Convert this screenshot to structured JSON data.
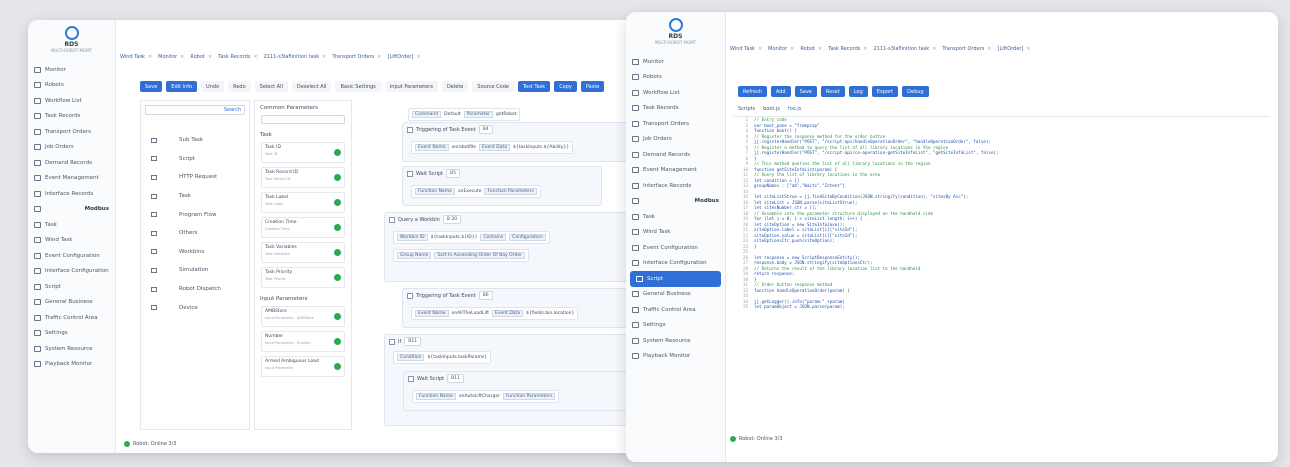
{
  "app": {
    "logo_name": "RDS",
    "logo_sub": "MULTI-ROBOT MGMT"
  },
  "colors": {
    "accent": "#2f6fd6",
    "online": "#2fa84f",
    "comment": "#2f8f46"
  },
  "left": {
    "sidebar": [
      {
        "label": "Monitor",
        "icon": "monitor-icon"
      },
      {
        "label": "Robots",
        "icon": "robot-icon"
      },
      {
        "label": "Workflow List",
        "icon": "list-icon"
      },
      {
        "label": "Task Records",
        "icon": "record-icon"
      },
      {
        "label": "Transport Orders",
        "icon": "transport-icon"
      },
      {
        "label": "Job Orders",
        "icon": "job-icon"
      },
      {
        "label": "Demand Records",
        "icon": "demand-icon"
      },
      {
        "label": "Event Management",
        "icon": "event-icon"
      },
      {
        "label": "Interface Records",
        "icon": "interface-icon"
      },
      {
        "label": "Modbus",
        "icon": "modbus-icon",
        "group": true
      },
      {
        "label": "Task",
        "icon": "task-icon"
      },
      {
        "label": "Wind Task",
        "icon": "wind-icon"
      },
      {
        "label": "Event Configuration",
        "icon": "event-config-icon"
      },
      {
        "label": "Interface Configuration",
        "icon": "interface-config-icon"
      },
      {
        "label": "Script",
        "icon": "script-icon"
      },
      {
        "label": "General Business",
        "icon": "business-icon"
      },
      {
        "label": "Traffic Control Area",
        "icon": "traffic-icon"
      },
      {
        "label": "Settings",
        "icon": "settings-icon"
      },
      {
        "label": "System Resource",
        "icon": "resource-icon"
      },
      {
        "label": "Playback Monitor",
        "icon": "playback-icon"
      }
    ],
    "tabs": [
      "Wind Task",
      "Monitor",
      "Robot",
      "Task Records",
      "2111-s3Iaflinition task",
      "Transport Orders",
      "[LiftOrder]"
    ],
    "toolbar": [
      "Save",
      "Edit Info",
      "Undo",
      "Redo",
      "Select All",
      "Deselect All",
      "Basic Settings",
      "Input Parameters",
      "Delete",
      "Source Code",
      "Test Task",
      "Copy",
      "Paste"
    ],
    "toolbar_primary": [
      0,
      1,
      10,
      11,
      12
    ],
    "search_label": "Search",
    "components": [
      "Sub Task",
      "Script",
      "HTTP Request",
      "Task",
      "Program Flow",
      "Others",
      "Workbins",
      "Simulation",
      "Robot Dispatch",
      "Device"
    ],
    "params_title": "Common Parameters",
    "task_title": "Task",
    "task_cards": [
      {
        "name": "Task ID",
        "desc": "Task ID"
      },
      {
        "name": "Task Record ID",
        "desc": "Task Record ID"
      },
      {
        "name": "Task Label",
        "desc": "Task Label"
      },
      {
        "name": "Creation Time",
        "desc": "Creation Time"
      },
      {
        "name": "Task Variables",
        "desc": "Task Variables"
      },
      {
        "name": "Task Priority",
        "desc": "Task Priority"
      }
    ],
    "input_title": "Input Parameters",
    "input_cards": [
      {
        "name": "AMBStore",
        "desc": "Input Parameter - AMBStore"
      },
      {
        "name": "Number",
        "desc": "Input Parameter - Number"
      },
      {
        "name": "Armed Ambiguous Load",
        "desc": "Input Parameter"
      }
    ],
    "flow": {
      "f1_cmd": "Command",
      "f1_val": "Default",
      "f1_param": "Parameter",
      "f1_pval": "getRobot",
      "f2_title": "Triggering of Task Event",
      "f2_badge": "B4",
      "f2_chip1": "Event Name",
      "f2_val1": "onrobotfile",
      "f2_chip2": "Event Data",
      "f2_val2": "${taskInputs.${Ability}}",
      "f3_title": "Wait Script",
      "f3_badge": "B5",
      "f3_chip": "Function Name",
      "f3_val": "onExecute",
      "f3_chip2": "Function Parameters",
      "f4_title": "Query a Workbin",
      "f4_badge": "B 30",
      "f4_chip1": "Workbin ID",
      "f4_val1": "${taskInputs.${ID}}",
      "f4_chip2": "Contains",
      "f4_chip3": "Configuration",
      "f4_chip4": "Group Name",
      "f4_chip5": "Sort In Ascending Order Of Bay Order",
      "f5_title": "Triggering of Task Event",
      "f5_badge": "B6",
      "f5_chip1": "Event Name",
      "f5_val1": "onAllTheLoadLift",
      "f5_chip2": "Event Data",
      "f5_val2": "${fields.bin.location}",
      "f6_title": "If",
      "f6_badge": "B11",
      "f6_chip": "Condition",
      "f6_val": "${taskInputs.taskParams}",
      "f7_title": "Wait Script",
      "f7_badge": "B11",
      "f7_chip": "Function Name",
      "f7_val": "onAutoLiftCharger",
      "f7_chip2": "Function Parameters"
    },
    "status": "Robot: Online 3/3"
  },
  "right": {
    "sidebar": [
      {
        "label": "Monitor",
        "icon": "monitor-icon"
      },
      {
        "label": "Robots",
        "icon": "robot-icon"
      },
      {
        "label": "Workflow List",
        "icon": "list-icon"
      },
      {
        "label": "Task Records",
        "icon": "record-icon"
      },
      {
        "label": "Transport Orders",
        "icon": "transport-icon"
      },
      {
        "label": "Job Orders",
        "icon": "job-icon"
      },
      {
        "label": "Demand Records",
        "icon": "demand-icon"
      },
      {
        "label": "Event Management",
        "icon": "event-icon"
      },
      {
        "label": "Interface Records",
        "icon": "interface-icon"
      },
      {
        "label": "Modbus",
        "icon": "modbus-icon",
        "group": true
      },
      {
        "label": "Task",
        "icon": "task-icon"
      },
      {
        "label": "Wind Task",
        "icon": "wind-icon"
      },
      {
        "label": "Event Configuration",
        "icon": "event-config-icon"
      },
      {
        "label": "Interface Configuration",
        "icon": "interface-config-icon"
      },
      {
        "label": "Script",
        "icon": "script-icon",
        "active": true
      },
      {
        "label": "General Business",
        "icon": "business-icon"
      },
      {
        "label": "Traffic Control Area",
        "icon": "traffic-icon"
      },
      {
        "label": "Settings",
        "icon": "settings-icon"
      },
      {
        "label": "System Resource",
        "icon": "resource-icon"
      },
      {
        "label": "Playback Monitor",
        "icon": "playback-icon"
      }
    ],
    "tabs": [
      "Wind Task",
      "Monitor",
      "Robot",
      "Task Records",
      "2111-s3Iaflinition task",
      "Transport Orders",
      "[LiftOrder]"
    ],
    "toolbar": [
      "Refresh",
      "Add",
      "Save",
      "Reset",
      "Log",
      "Export",
      "Debug"
    ],
    "code_tabs": [
      "Scripts",
      "boot.js",
      "foo.js"
    ],
    "code": [
      {
        "t": "// Entry code",
        "c": true
      },
      {
        "t": "var boot_pane = \"fromprop\"",
        "c": false
      },
      {
        "t": "function boot() {",
        "c": false
      },
      {
        "t": "  // Register the response method for the order button",
        "c": true
      },
      {
        "t": "  jj.registerHandler(\"POST\", \"/script-api/handleOperationOrder\", \"handleOperationOrder\", false);",
        "c": false
      },
      {
        "t": "  // Register a method to query the list of all library locations in the region",
        "c": true
      },
      {
        "t": "  jj.registerHandler(\"POST\", \"/script-api/co-operation-getSiteInfoList\", \"getSiteInfoList\", false);",
        "c": false
      },
      {
        "t": "}",
        "c": false
      },
      {
        "t": "// This method queries the list of all library locations in the region",
        "c": true
      },
      {
        "t": "function getSiteInfoList(param) {",
        "c": false
      },
      {
        "t": "  // Query the list of library locations in the area",
        "c": true
      },
      {
        "t": "  let condition = {}",
        "c": false
      },
      {
        "t": "  groupNames : [\"ab\",\"Waits\",\"Intent\"]",
        "c": false
      },
      {
        "t": "",
        "c": false
      },
      {
        "t": "  let siteListStrue = jj.findSiteByCondition(JSON.stringify(condition), \"sitesBy Asc\");",
        "c": false
      },
      {
        "t": "  let siteList = JSON.parse(siteListStrue);",
        "c": false
      },
      {
        "t": "  let sitesNumber_ctr = [];",
        "c": false
      },
      {
        "t": "  // Assemble into the parameter structure displayed on the handheld side",
        "c": true
      },
      {
        "t": "  for (let i = 0; i < siteList.length; i++) {",
        "c": false
      },
      {
        "t": "    let siteOption = new SiteInfoJava();",
        "c": false
      },
      {
        "t": "    siteOption.label = siteList[i][\"siteId\"];",
        "c": false
      },
      {
        "t": "    siteOption.value = siteList[i][\"siteId\"];",
        "c": false
      },
      {
        "t": "    siteOptionsCtr.push(siteOption);",
        "c": false
      },
      {
        "t": "  }",
        "c": false
      },
      {
        "t": "",
        "c": false
      },
      {
        "t": "  let response = new ScriptResponseEntity();",
        "c": false
      },
      {
        "t": "  response.body = JSON.stringify(siteOptionsCtr);",
        "c": false
      },
      {
        "t": "  // Returns the result of the library location list to the handheld",
        "c": true
      },
      {
        "t": "  return response;",
        "c": false
      },
      {
        "t": "}",
        "c": false
      },
      {
        "t": "// Order button response method",
        "c": true
      },
      {
        "t": "function handleOperationOrder(param) {",
        "c": false
      },
      {
        "t": "",
        "c": false
      },
      {
        "t": "  jj.getLogger().info(\"param:\" +param)",
        "c": false
      },
      {
        "t": "  let paramObject = JSON.parse(param);",
        "c": false
      }
    ],
    "status": "Robot: Online 3/3"
  }
}
